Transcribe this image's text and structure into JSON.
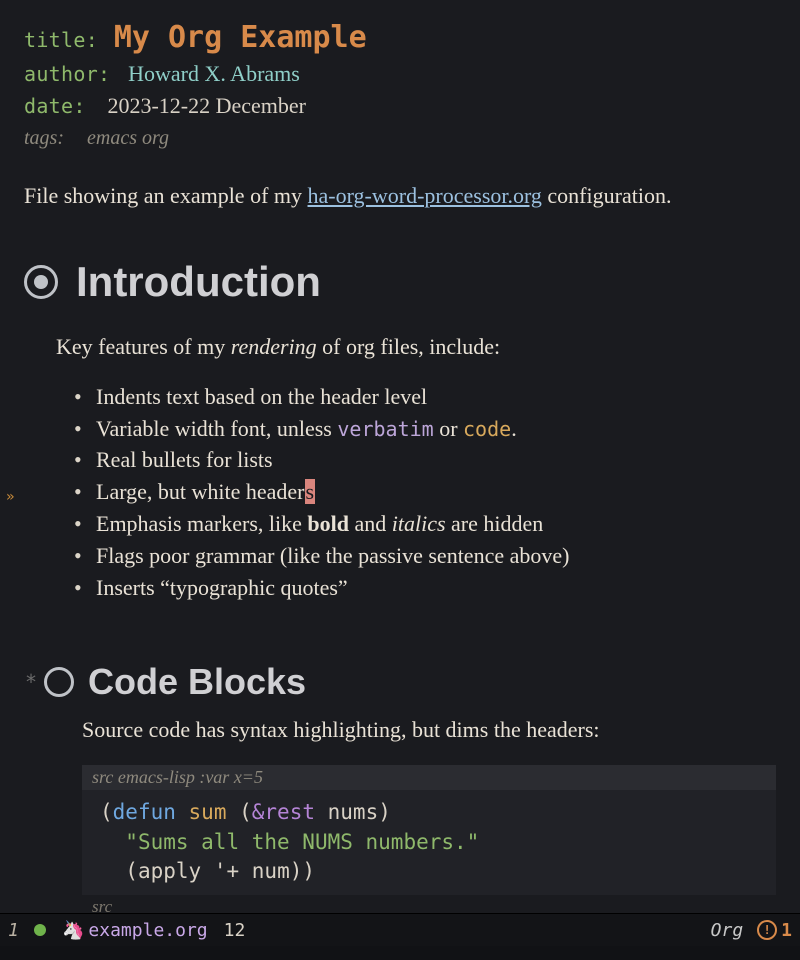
{
  "header": {
    "title_key": "title",
    "title": "My Org Example",
    "author_key": "author",
    "author": "Howard X. Abrams",
    "date_key": "date",
    "date": "2023-12-22 December",
    "tags_key": "tags:",
    "tags": "emacs org"
  },
  "intro": {
    "pre": "File showing an example of my ",
    "link": "ha-org-word-processor.org",
    "post": " configuration."
  },
  "h1": {
    "title": "Introduction"
  },
  "features": {
    "lead_pre": "Key features of my ",
    "lead_em": "rendering",
    "lead_post": " of org files, include:",
    "items": [
      {
        "text": "Indents text based on the header level"
      },
      {
        "pre": "Variable width font, unless ",
        "verbatim": "verbatim",
        "mid": " or ",
        "code": "code",
        "post": "."
      },
      {
        "text": "Real bullets for lists"
      },
      {
        "pre": "Large, but white header",
        "cursor": "s"
      },
      {
        "pre": "Emphasis markers, like ",
        "bold": "bold",
        "mid": " and ",
        "ital": "italics",
        "post": " are hidden"
      },
      {
        "text": "Flags poor grammar (like the passive sentence above)"
      },
      {
        "text": "Inserts “typographic quotes”"
      }
    ]
  },
  "h2": {
    "star": "*",
    "title": "Code Blocks"
  },
  "codesec": {
    "para": "Source code has syntax highlighting, but dims the headers:",
    "begin_label": "src",
    "begin_lang": " emacs-lisp :var x=5",
    "code": {
      "l1_open": "(",
      "l1_defun": "defun",
      "l1_sp1": " ",
      "l1_fn": "sum",
      "l1_sp2": " (",
      "l1_amp": "&rest",
      "l1_sp3": " ",
      "l1_arg": "nums",
      "l1_close": ")",
      "l2_indent": "  ",
      "l2_str": "\"Sums all the NUMS numbers.\"",
      "l3_indent": "  ",
      "l3_open": "(",
      "l3_apply": "apply",
      "l3_sp": " ",
      "l3_quote": "'+",
      "l3_sp2": " ",
      "l3_arg": "num",
      "l3_close": "))"
    },
    "end_label": "src"
  },
  "modeline": {
    "win": "1",
    "file": "example.org",
    "line": "12",
    "mode": "Org",
    "warn_count": "1",
    "warn_mark": "!"
  },
  "gutter": {
    "marker": "»"
  }
}
